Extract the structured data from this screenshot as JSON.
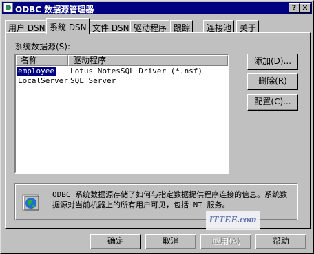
{
  "window": {
    "title": "ODBC 数据源管理器",
    "help_glyph": "?",
    "close_glyph": "✕"
  },
  "tabs": [
    {
      "label": "用户 DSN"
    },
    {
      "label": "系统 DSN",
      "active": true
    },
    {
      "label": "文件 DSN"
    },
    {
      "label": "驱动程序"
    },
    {
      "label": "跟踪"
    },
    {
      "label": "连接池"
    },
    {
      "label": "关于"
    }
  ],
  "sources_label": "系统数据源(S):",
  "list": {
    "columns": [
      "名称",
      "驱动程序"
    ],
    "rows": [
      {
        "name": "employee",
        "driver": "Lotus NotesSQL Driver (*.nsf)",
        "selected": true
      },
      {
        "name": "LocalServer",
        "driver": "SQL Server"
      }
    ]
  },
  "side_buttons": {
    "add": "添加(D)...",
    "remove": "删除(R)",
    "configure": "配置(C)..."
  },
  "info_text": "ODBC 系统数据源存储了如何与指定数据提供程序连接的信息。系统数据源对当前机器上的所有用户可见，包括 NT 服务。",
  "watermark": "ITTEE.com",
  "footer_buttons": {
    "ok": "确定",
    "cancel": "取消",
    "apply": "应用(A)",
    "help": "帮助"
  },
  "colors": {
    "title_bar": "#000080",
    "face": "#c0c0c0",
    "selection": "#000080"
  }
}
